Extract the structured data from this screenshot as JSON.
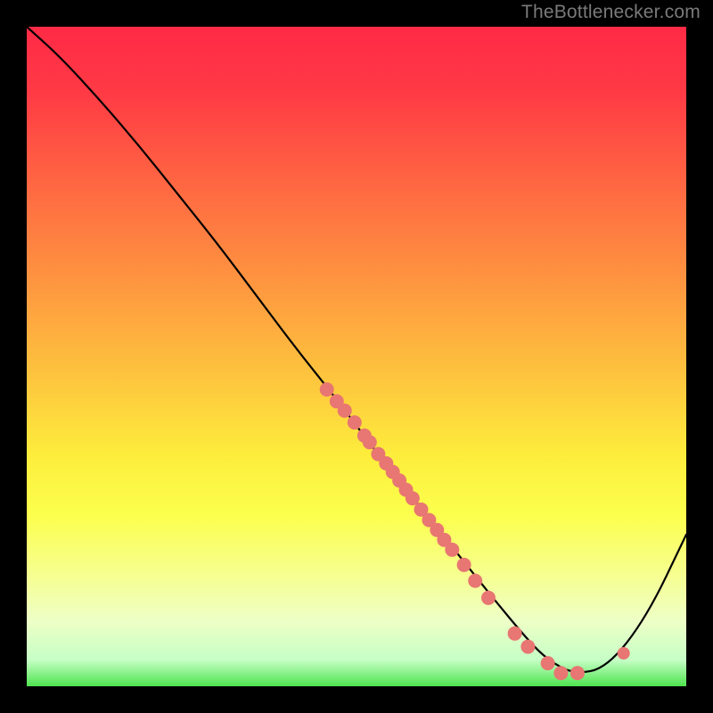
{
  "attribution": "TheBottlenecker.com",
  "chart_data": {
    "type": "line",
    "title": "",
    "xlabel": "",
    "ylabel": "",
    "xlim": [
      0,
      1
    ],
    "ylim": [
      0,
      1
    ],
    "note": "No numeric tick labels are rendered in the source image; x/y reported in normalized [0,1] coordinates.",
    "series": [
      {
        "name": "curve",
        "x": [
          0.0,
          0.05,
          0.11,
          0.17,
          0.23,
          0.29,
          0.35,
          0.41,
          0.47,
          0.53,
          0.59,
          0.65,
          0.71,
          0.76,
          0.79,
          0.83,
          0.88,
          0.94,
          1.0
        ],
        "y": [
          1.0,
          0.955,
          0.89,
          0.82,
          0.745,
          0.67,
          0.59,
          0.51,
          0.435,
          0.355,
          0.28,
          0.205,
          0.13,
          0.07,
          0.04,
          0.018,
          0.028,
          0.105,
          0.23
        ]
      }
    ],
    "markers": [
      {
        "x": 0.455,
        "y": 0.45,
        "r": 8
      },
      {
        "x": 0.47,
        "y": 0.432,
        "r": 8
      },
      {
        "x": 0.482,
        "y": 0.418,
        "r": 8
      },
      {
        "x": 0.497,
        "y": 0.4,
        "r": 8
      },
      {
        "x": 0.512,
        "y": 0.38,
        "r": 8
      },
      {
        "x": 0.52,
        "y": 0.37,
        "r": 8
      },
      {
        "x": 0.533,
        "y": 0.352,
        "r": 8
      },
      {
        "x": 0.545,
        "y": 0.338,
        "r": 8
      },
      {
        "x": 0.555,
        "y": 0.325,
        "r": 8
      },
      {
        "x": 0.565,
        "y": 0.312,
        "r": 8
      },
      {
        "x": 0.575,
        "y": 0.298,
        "r": 8
      },
      {
        "x": 0.585,
        "y": 0.285,
        "r": 8
      },
      {
        "x": 0.598,
        "y": 0.268,
        "r": 8
      },
      {
        "x": 0.61,
        "y": 0.252,
        "r": 8
      },
      {
        "x": 0.622,
        "y": 0.237,
        "r": 8
      },
      {
        "x": 0.633,
        "y": 0.222,
        "r": 8
      },
      {
        "x": 0.645,
        "y": 0.207,
        "r": 8
      },
      {
        "x": 0.663,
        "y": 0.184,
        "r": 8
      },
      {
        "x": 0.68,
        "y": 0.16,
        "r": 8
      },
      {
        "x": 0.7,
        "y": 0.134,
        "r": 8
      },
      {
        "x": 0.74,
        "y": 0.08,
        "r": 8
      },
      {
        "x": 0.76,
        "y": 0.06,
        "r": 8
      },
      {
        "x": 0.79,
        "y": 0.035,
        "r": 8
      },
      {
        "x": 0.81,
        "y": 0.02,
        "r": 8
      },
      {
        "x": 0.835,
        "y": 0.02,
        "r": 8
      },
      {
        "x": 0.905,
        "y": 0.05,
        "r": 7
      }
    ],
    "marker_color": "#e87672",
    "background": "red-yellow-green vertical gradient"
  }
}
